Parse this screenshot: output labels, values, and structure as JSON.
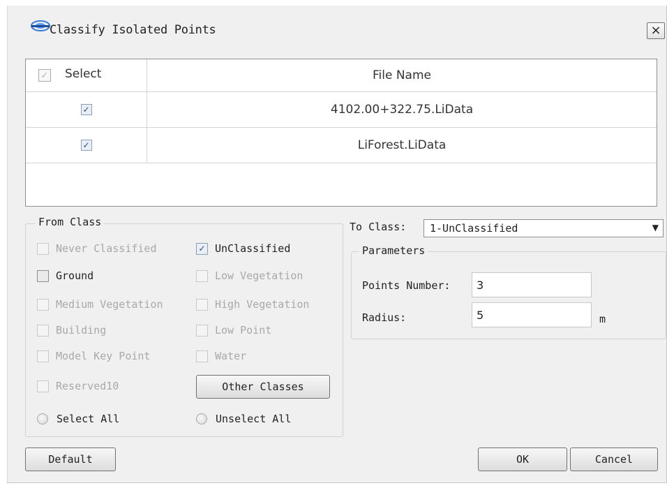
{
  "window": {
    "title": "Classify Isolated Points",
    "close_symbol": "×",
    "logo_icon": "lidar360-logo-icon"
  },
  "file_table": {
    "columns": [
      "Select",
      "File Name"
    ],
    "header_checked": true,
    "rows": [
      {
        "checked": true,
        "file_name": "4102.00+322.75.LiData"
      },
      {
        "checked": true,
        "file_name": "LiForest.LiData"
      }
    ]
  },
  "from_class": {
    "title": "From Class",
    "classes": [
      {
        "label": "Never Classified",
        "checked": false,
        "enabled": false
      },
      {
        "label": "UnClassified",
        "checked": true,
        "enabled": true
      },
      {
        "label": "Ground",
        "checked": false,
        "enabled": true
      },
      {
        "label": "Low Vegetation",
        "checked": false,
        "enabled": false
      },
      {
        "label": "Medium Vegetation",
        "checked": false,
        "enabled": false
      },
      {
        "label": "High Vegetation",
        "checked": false,
        "enabled": false
      },
      {
        "label": "Building",
        "checked": false,
        "enabled": false
      },
      {
        "label": "Low Point",
        "checked": false,
        "enabled": false
      },
      {
        "label": "Model Key Point",
        "checked": false,
        "enabled": false
      },
      {
        "label": "Water",
        "checked": false,
        "enabled": false
      },
      {
        "label": "Reserved10",
        "checked": false,
        "enabled": false
      }
    ],
    "other_classes_label": "Other Classes",
    "select_all_label": "Select All",
    "unselect_all_label": "Unselect All"
  },
  "to_class": {
    "label": "To Class:",
    "selected": "1-UnClassified",
    "arrow": "▼"
  },
  "parameters": {
    "title": "Parameters",
    "points_number_label": "Points Number:",
    "points_number_value": "3",
    "radius_label": "Radius:",
    "radius_value": "5",
    "radius_unit": "m"
  },
  "buttons": {
    "default": "Default",
    "ok": "OK",
    "cancel": "Cancel"
  },
  "check_symbol": "✓"
}
